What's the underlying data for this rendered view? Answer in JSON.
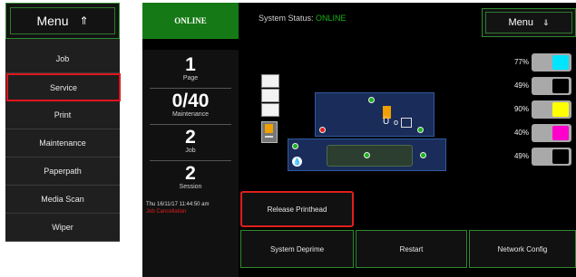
{
  "left_menu": {
    "title": "Menu",
    "arrow": "⇑",
    "items": [
      "Job",
      "Service",
      "Print",
      "Maintenance",
      "Paperpath",
      "Media Scan",
      "Wiper"
    ],
    "selected": "Service"
  },
  "header": {
    "online_label": "ONLINE",
    "status_label": "System Status:",
    "status_value": "ONLINE",
    "menu_label": "Menu",
    "menu_arrow": "⇓"
  },
  "stats": [
    {
      "value": "1",
      "label": "Page"
    },
    {
      "value": "0/40",
      "label": "Maintenance"
    },
    {
      "value": "2",
      "label": "Job"
    },
    {
      "value": "2",
      "label": "Session"
    }
  ],
  "datetime": "Thu 16/11/17 11:44:50 am",
  "job_status": "Job Cancellation",
  "ink_levels": [
    {
      "pct": "77%",
      "color": "#00e5ff"
    },
    {
      "pct": "49%",
      "color": "#000000"
    },
    {
      "pct": "90%",
      "color": "#ffff00"
    },
    {
      "pct": "40%",
      "color": "#ff00cc"
    },
    {
      "pct": "49%",
      "color": "#000000"
    }
  ],
  "diagram": {
    "carriage_symbols": [
      "Ü",
      "o"
    ],
    "icons": [
      "paper-tray-icon",
      "cartridge-icon",
      "printhead-icon",
      "ink-drop-icon",
      "status-dot-icon"
    ]
  },
  "buttons": {
    "release_printhead": "Release Printhead",
    "system_deprime": "System Deprime",
    "restart": "Restart",
    "network_config": "Network Config"
  }
}
